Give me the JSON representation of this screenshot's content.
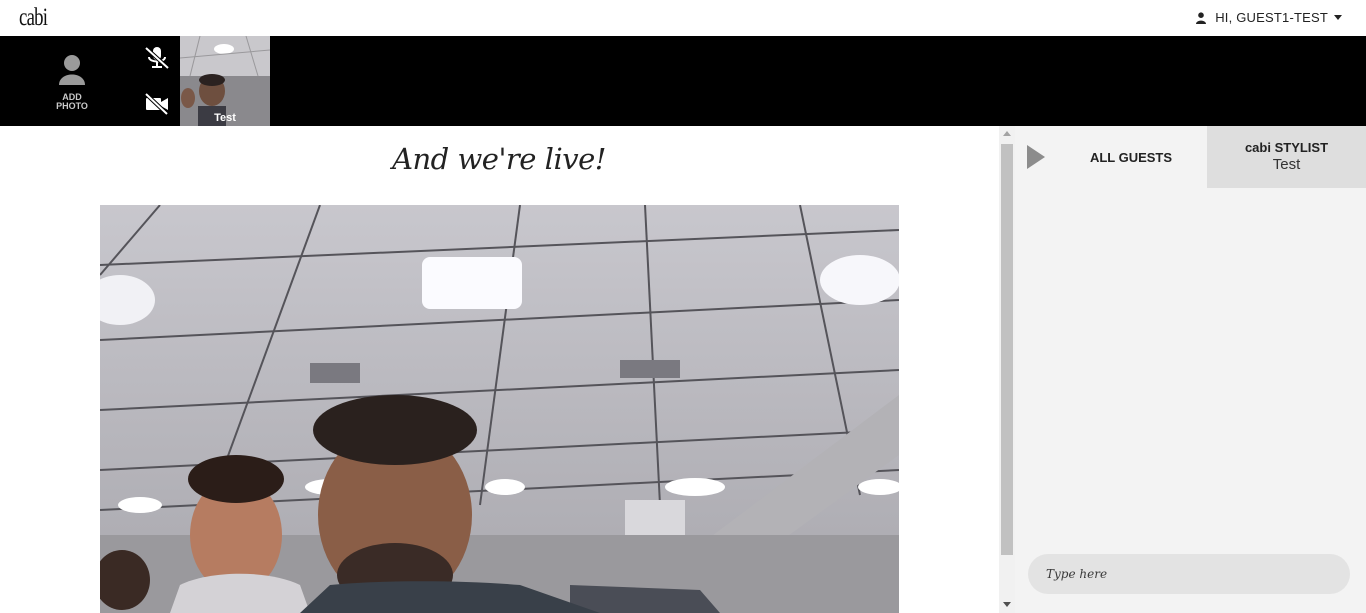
{
  "header": {
    "logo": "cabi",
    "user_greeting": "HI, GUEST1-TEST"
  },
  "strip": {
    "add_photo_line1": "ADD",
    "add_photo_line2": "PHOTO",
    "participant_name": "Test"
  },
  "main": {
    "title": "And we're live!"
  },
  "sidebar": {
    "tab_all_guests": "ALL GUESTS",
    "tab_stylist_title": "cabi STYLIST",
    "tab_stylist_name": "Test",
    "chat_placeholder": "Type here"
  },
  "colors": {
    "strip_background": "#000000",
    "sidebar_background": "#f3f3f3",
    "active_tab_background": "#dedede"
  },
  "icons": [
    "user-icon",
    "caret-down-icon",
    "avatar-placeholder-icon",
    "microphone-muted-icon",
    "camera-off-icon",
    "collapse-arrow-icon"
  ]
}
